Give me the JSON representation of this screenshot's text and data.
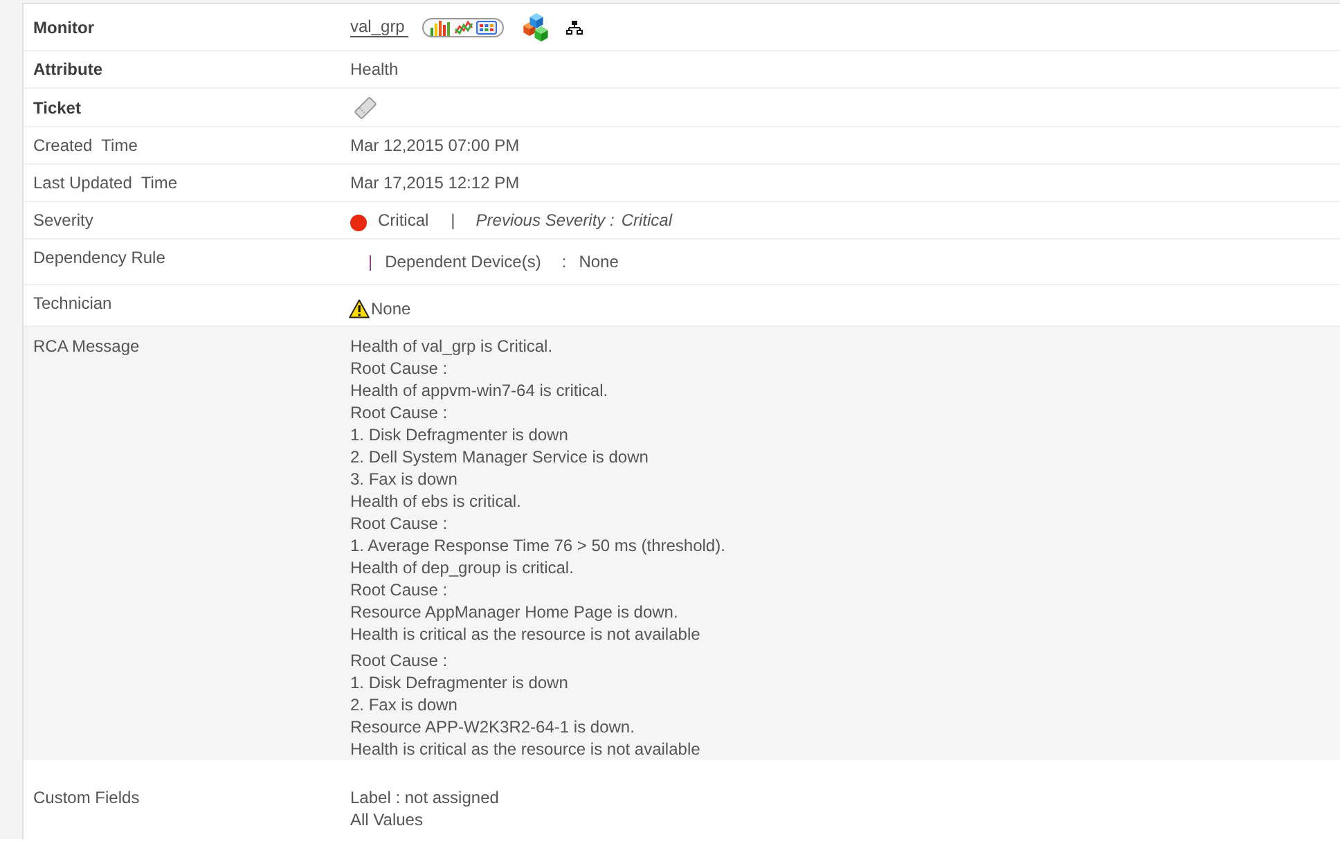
{
  "rows": [
    {
      "kind": "monitor",
      "label": "Monitor",
      "bold": true,
      "link": "val_grp"
    },
    {
      "kind": "text",
      "label": "Attribute",
      "bold": true,
      "value": "Health"
    },
    {
      "kind": "ticket",
      "label": "Ticket",
      "bold": true
    },
    {
      "kind": "text",
      "label": "Created  Time",
      "bold": false,
      "value": "Mar 12,2015 07:00 PM"
    },
    {
      "kind": "text",
      "label": "Last Updated  Time",
      "bold": false,
      "value": "Mar 17,2015 12:12 PM"
    },
    {
      "kind": "severity",
      "label": "Severity",
      "bold": false,
      "color": "#e8290f",
      "value": "Critical",
      "separator": "|",
      "previous_label": "Previous Severity :",
      "previous_value": "Critical"
    },
    {
      "kind": "dependency",
      "label": "Dependency Rule",
      "bold": false,
      "separator": "|",
      "field_label": "Dependent Device(s)",
      "colon": ":",
      "value": "None"
    },
    {
      "kind": "technician",
      "label": "Technician",
      "bold": false,
      "value": "None"
    },
    {
      "kind": "message",
      "label": "RCA Message",
      "bold": false,
      "blocks": [
        [
          "Health of val_grp is Critical.",
          "Root Cause :",
          "Health of appvm-win7-64 is critical.",
          "Root Cause :",
          "1. Disk Defragmenter is down",
          "2. Dell System Manager Service is down",
          "3. Fax is down",
          "Health of ebs is critical.",
          "Root Cause :",
          "1. Average Response Time 76 > 50 ms (threshold).",
          "Health of dep_group is critical.",
          "Root Cause :",
          "Resource AppManager Home Page is down.",
          "Health is critical as the resource is not available"
        ],
        [
          "Root Cause :",
          "1. Disk Defragmenter is down",
          "2. Fax is down",
          "Resource APP-W2K3R2-64-1 is down.",
          "Health is critical as the resource is not available"
        ]
      ]
    },
    {
      "kind": "lines",
      "label": "Custom Fields",
      "bold": false,
      "lines": [
        "Label : not assigned",
        "All Values"
      ]
    }
  ]
}
